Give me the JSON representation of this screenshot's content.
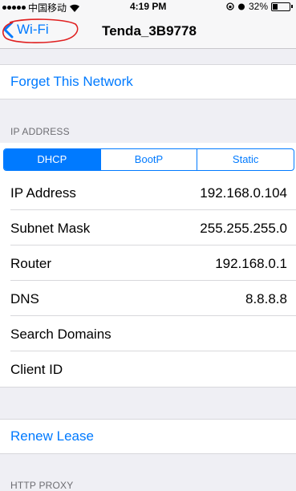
{
  "status": {
    "carrier": "中国移动",
    "time": "4:19 PM",
    "battery": "32%",
    "battery_level": 0.32
  },
  "nav": {
    "back_label": "Wi-Fi",
    "title": "Tenda_3B9778"
  },
  "forget_label": "Forget This Network",
  "ip_section_header": "IP ADDRESS",
  "segments": [
    "DHCP",
    "BootP",
    "Static"
  ],
  "selected_segment": "DHCP",
  "info": [
    {
      "label": "IP Address",
      "value": "192.168.0.104"
    },
    {
      "label": "Subnet Mask",
      "value": "255.255.255.0"
    },
    {
      "label": "Router",
      "value": "192.168.0.1"
    },
    {
      "label": "DNS",
      "value": "8.8.8.8"
    },
    {
      "label": "Search Domains",
      "value": ""
    },
    {
      "label": "Client ID",
      "value": ""
    }
  ],
  "renew_label": "Renew Lease",
  "proxy_section_header": "HTTP PROXY",
  "colors": {
    "accent": "#007aff",
    "background": "#efeff4",
    "annotation": "#e02020"
  }
}
